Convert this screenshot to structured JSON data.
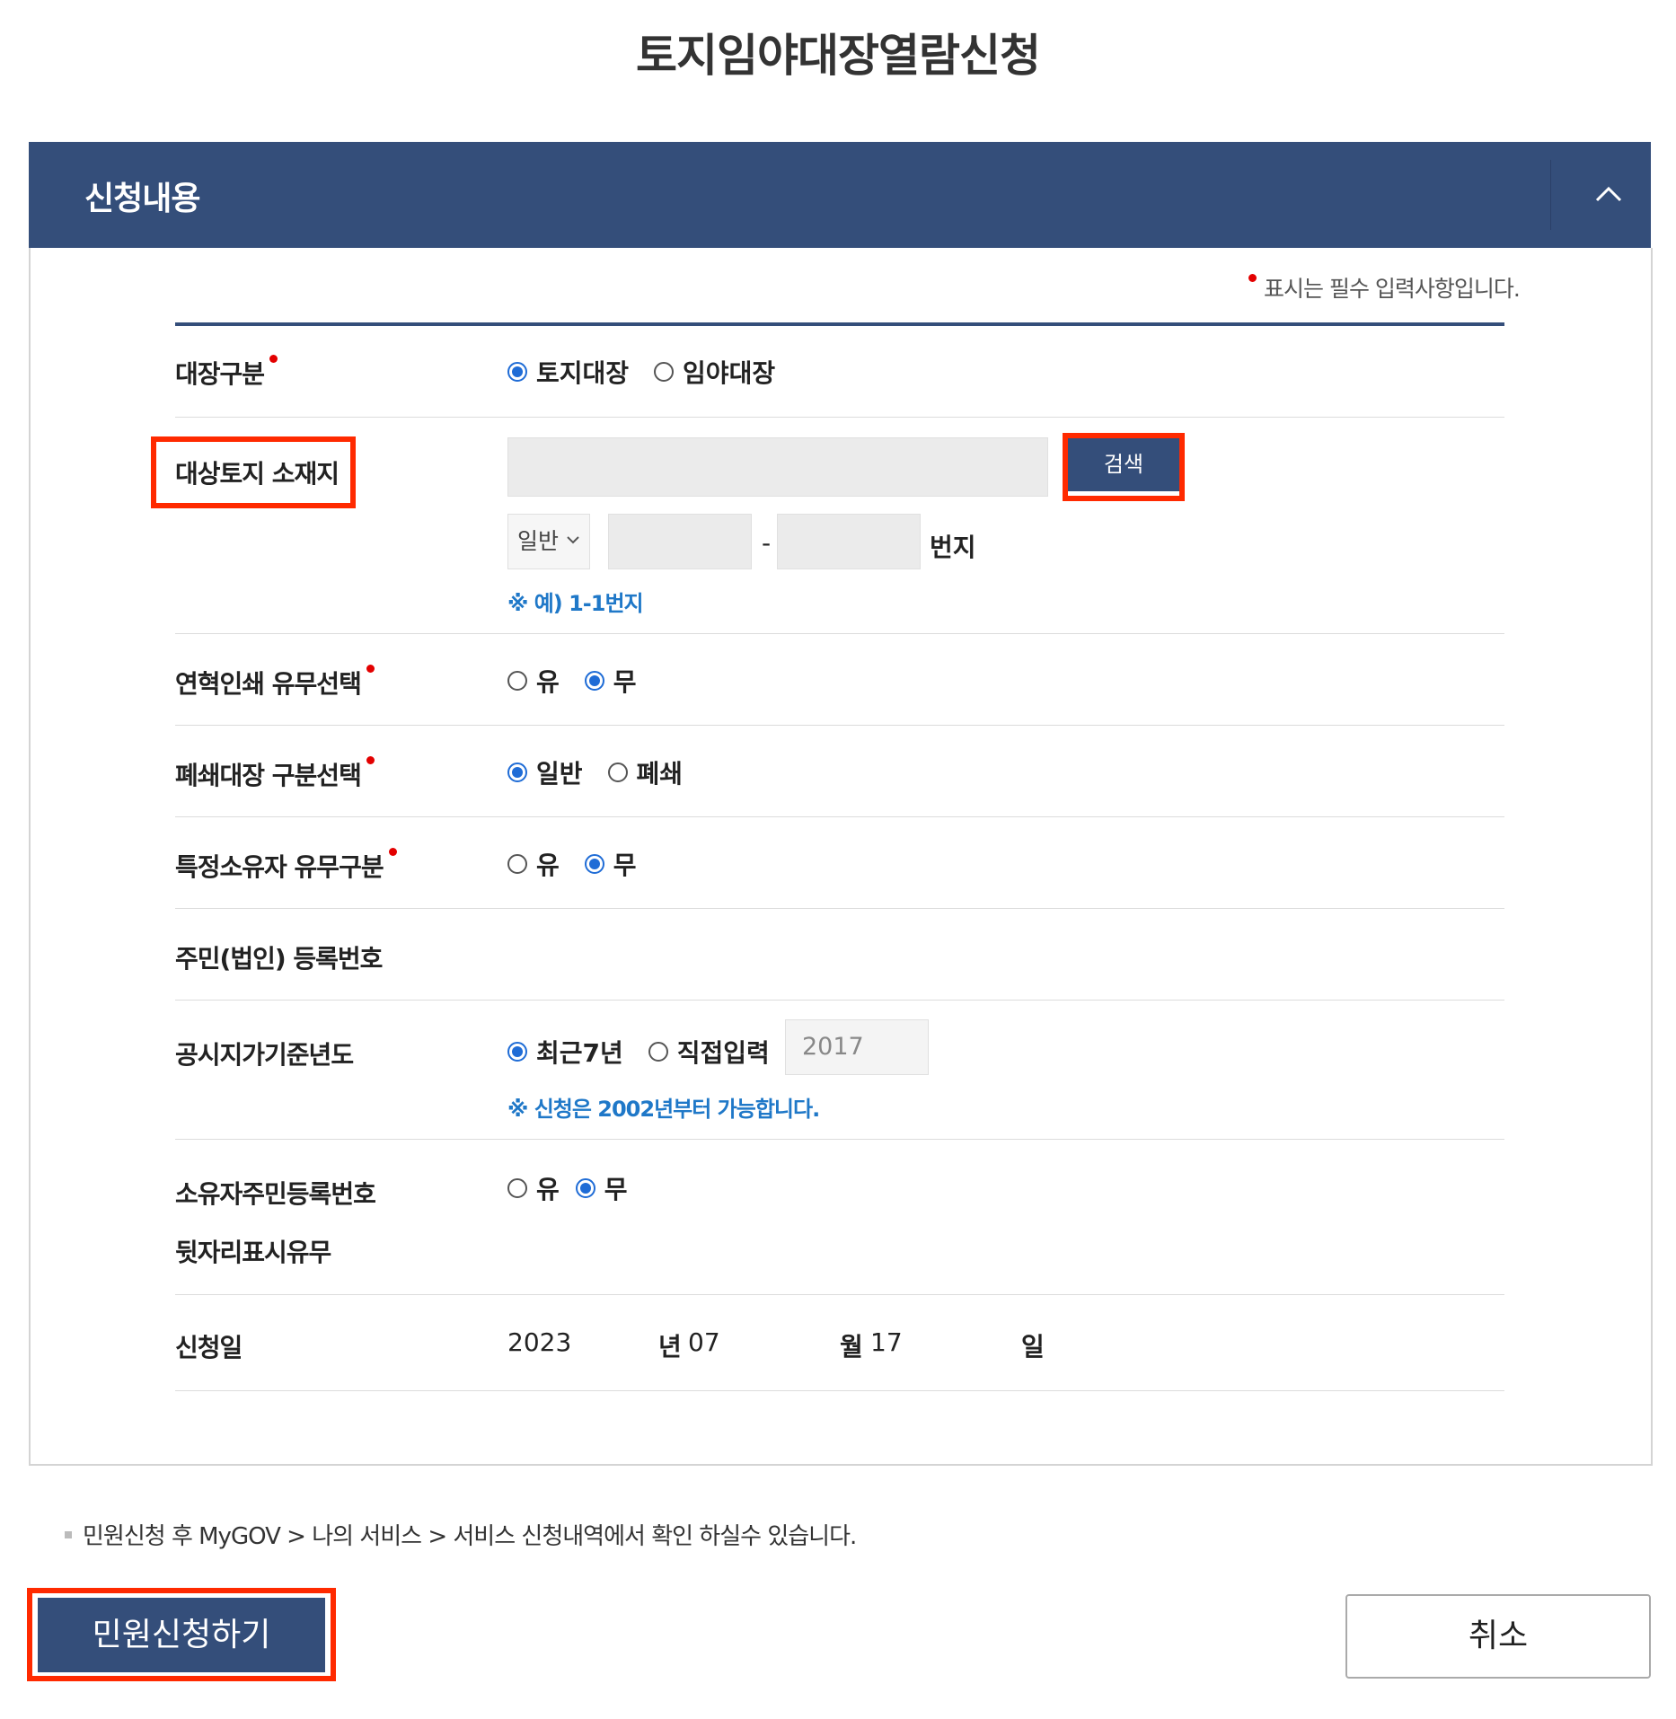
{
  "page": {
    "title": "토지임야대장열람신청"
  },
  "section": {
    "title": "신청내용",
    "collapse_icon": "chevron-up-icon"
  },
  "required_note": "표시는 필수 입력사항입니다.",
  "ledger_type": {
    "label": "대장구분",
    "options": [
      {
        "label": "토지대장",
        "selected": true
      },
      {
        "label": "임야대장",
        "selected": false
      }
    ]
  },
  "location": {
    "label": "대상토지 소재지",
    "search_button": "검색",
    "lot_type": "일반",
    "lot_main": "",
    "lot_sep": "-",
    "lot_sub": "",
    "lot_suffix": "번지",
    "hint": "※ 예) 1-1번지"
  },
  "history_print": {
    "label": "연혁인쇄 유무선택",
    "options": [
      {
        "label": "유",
        "selected": false
      },
      {
        "label": "무",
        "selected": true
      }
    ]
  },
  "closed_ledger": {
    "label": "폐쇄대장 구분선택",
    "options": [
      {
        "label": "일반",
        "selected": true
      },
      {
        "label": "폐쇄",
        "selected": false
      }
    ]
  },
  "specific_owner": {
    "label": "특정소유자 유무구분",
    "options": [
      {
        "label": "유",
        "selected": false
      },
      {
        "label": "무",
        "selected": true
      }
    ]
  },
  "resident_number": {
    "label": "주민(법인) 등록번호"
  },
  "price_year": {
    "label": "공시지가기준년도",
    "options": [
      {
        "label": "최근7년",
        "selected": true
      },
      {
        "label": "직접입력",
        "selected": false
      }
    ],
    "year_value": "2017",
    "hint": "※ 신청은 2002년부터 가능합니다."
  },
  "owner_id_suffix": {
    "label_line1": "소유자주민등록번호",
    "label_line2": "뒷자리표시유무",
    "options": [
      {
        "label": "유",
        "selected": false
      },
      {
        "label": "무",
        "selected": true
      }
    ]
  },
  "apply_date": {
    "label": "신청일",
    "year": "2023",
    "year_unit": "년",
    "month": "07",
    "month_unit": "월",
    "day": "17",
    "day_unit": "일"
  },
  "footnote": "민원신청 후 MyGOV > 나의 서비스 > 서비스 신청내역에서 확인 하실수 있습니다.",
  "buttons": {
    "submit": "민원신청하기",
    "cancel": "취소"
  },
  "colors": {
    "header_bg": "#344e7a",
    "accent_blue": "#1f6cd6",
    "hint_blue": "#1f78c8",
    "required_red": "#e30000",
    "highlight_red": "#ff2a00"
  }
}
